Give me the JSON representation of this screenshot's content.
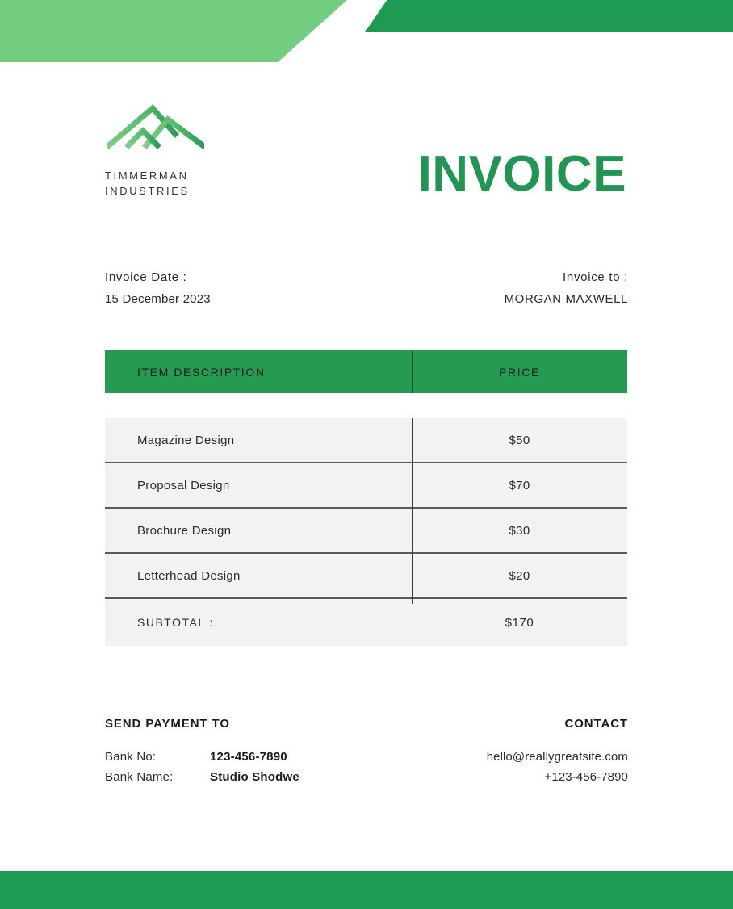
{
  "theme": {
    "green_light": "#72cd81",
    "green_dark": "#1e9a52",
    "green_table_header": "#249b51",
    "green_title": "#219653",
    "row_bg": "#f2f2f2",
    "text_dark": "#2b2b2b"
  },
  "brand": {
    "logo_icon": "mountain-peaks-icon",
    "name_line1": "TIMMERMAN",
    "name_line2": "INDUSTRIES"
  },
  "header": {
    "title": "INVOICE"
  },
  "meta": {
    "date_label": "Invoice Date :",
    "date_value": "15 December 2023",
    "to_label": "Invoice to :",
    "to_value": "MORGAN MAXWELL"
  },
  "table": {
    "columns": [
      "ITEM DESCRIPTION",
      "PRICE"
    ],
    "rows": [
      {
        "description": "Magazine Design",
        "price": "$50"
      },
      {
        "description": "Proposal Design",
        "price": "$70"
      },
      {
        "description": "Brochure Design",
        "price": "$30"
      },
      {
        "description": "Letterhead Design",
        "price": "$20"
      }
    ],
    "subtotal_label": "SUBTOTAL :",
    "subtotal_value": "$170"
  },
  "payment": {
    "heading": "SEND PAYMENT TO",
    "bank_no_label": "Bank No:",
    "bank_no_value": "123-456-7890",
    "bank_name_label": "Bank Name:",
    "bank_name_value": "Studio Shodwe"
  },
  "contact": {
    "heading": "CONTACT",
    "email": "hello@reallygreatsite.com",
    "phone": "+123-456-7890"
  }
}
